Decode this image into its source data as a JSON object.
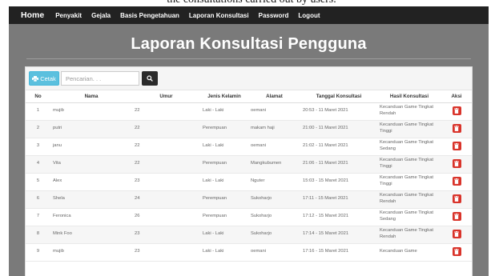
{
  "caption": "the consultations carried out by users.",
  "navbar": {
    "brand": "Home",
    "items": [
      {
        "label": "Penyakit",
        "name": "nav-item-penyakit"
      },
      {
        "label": "Gejala",
        "name": "nav-item-gejala"
      },
      {
        "label": "Basis Pengetahuan",
        "name": "nav-item-basis-pengetahuan"
      },
      {
        "label": "Laporan Konsultasi",
        "name": "nav-item-laporan-konsultasi"
      },
      {
        "label": "Password",
        "name": "nav-item-password"
      },
      {
        "label": "Logout",
        "name": "nav-item-logout"
      }
    ]
  },
  "page": {
    "title": "Laporan Konsultasi Pengguna"
  },
  "toolbar": {
    "print_label": "Cetak",
    "print_icon": "print-icon",
    "search_placeholder": "Pencarian. . .",
    "search_icon": "search-icon"
  },
  "table": {
    "headers": [
      "No",
      "Nama",
      "Umur",
      "Jenis Kelamin",
      "Alamat",
      "Tanggal Konsultasi",
      "Hasil Konsultasi",
      "Aksi"
    ],
    "delete_icon": "trash-icon",
    "delete_color": "#d9342b",
    "rows": [
      {
        "no": "1",
        "nama": "mujib",
        "umur": "22",
        "jk": "Laki - Laki",
        "alamat": "oemani",
        "tanggal": "20:53 - 11 Maret 2021",
        "hasil": "Kecanduan Game Tingkat Rendah"
      },
      {
        "no": "2",
        "nama": "putri",
        "umur": "22",
        "jk": "Perempuan",
        "alamat": "makam haji",
        "tanggal": "21:00 - 11 Maret 2021",
        "hasil": "Kecanduan Game Tingkat Tinggi"
      },
      {
        "no": "3",
        "nama": "janu",
        "umur": "22",
        "jk": "Laki - Laki",
        "alamat": "oemani",
        "tanggal": "21:02 - 11 Maret 2021",
        "hasil": "Kecanduan Game Tingkat Sedang"
      },
      {
        "no": "4",
        "nama": "Vita",
        "umur": "22",
        "jk": "Perempuan",
        "alamat": "Mangkubumen",
        "tanggal": "21:06 - 11 Maret 2021",
        "hasil": "Kecanduan Game Tingkat Tinggi"
      },
      {
        "no": "5",
        "nama": "Alex",
        "umur": "23",
        "jk": "Laki - Laki",
        "alamat": "Nguter",
        "tanggal": "15:03 - 15 Maret 2021",
        "hasil": "Kecanduan Game Tingkat Tinggi"
      },
      {
        "no": "6",
        "nama": "Shela",
        "umur": "24",
        "jk": "Perempuan",
        "alamat": "Sukoharjo",
        "tanggal": "17:11 - 15 Maret 2021",
        "hasil": "Kecanduan Game Tingkat Rendah"
      },
      {
        "no": "7",
        "nama": "Feronica",
        "umur": "26",
        "jk": "Perempuan",
        "alamat": "Sukoharjo",
        "tanggal": "17:12 - 15 Maret 2021",
        "hasil": "Kecanduan Game Tingkat Sedang"
      },
      {
        "no": "8",
        "nama": "Mink Foo",
        "umur": "23",
        "jk": "Laki - Laki",
        "alamat": "Sukoharjo",
        "tanggal": "17:14 - 15 Maret 2021",
        "hasil": "Kecanduan Game Tingkat Rendah"
      },
      {
        "no": "9",
        "nama": "mujib",
        "umur": "23",
        "jk": "Laki - Laki",
        "alamat": "oemani",
        "tanggal": "17:16 - 15 Maret 2021",
        "hasil": "Kecanduan Game"
      }
    ]
  }
}
